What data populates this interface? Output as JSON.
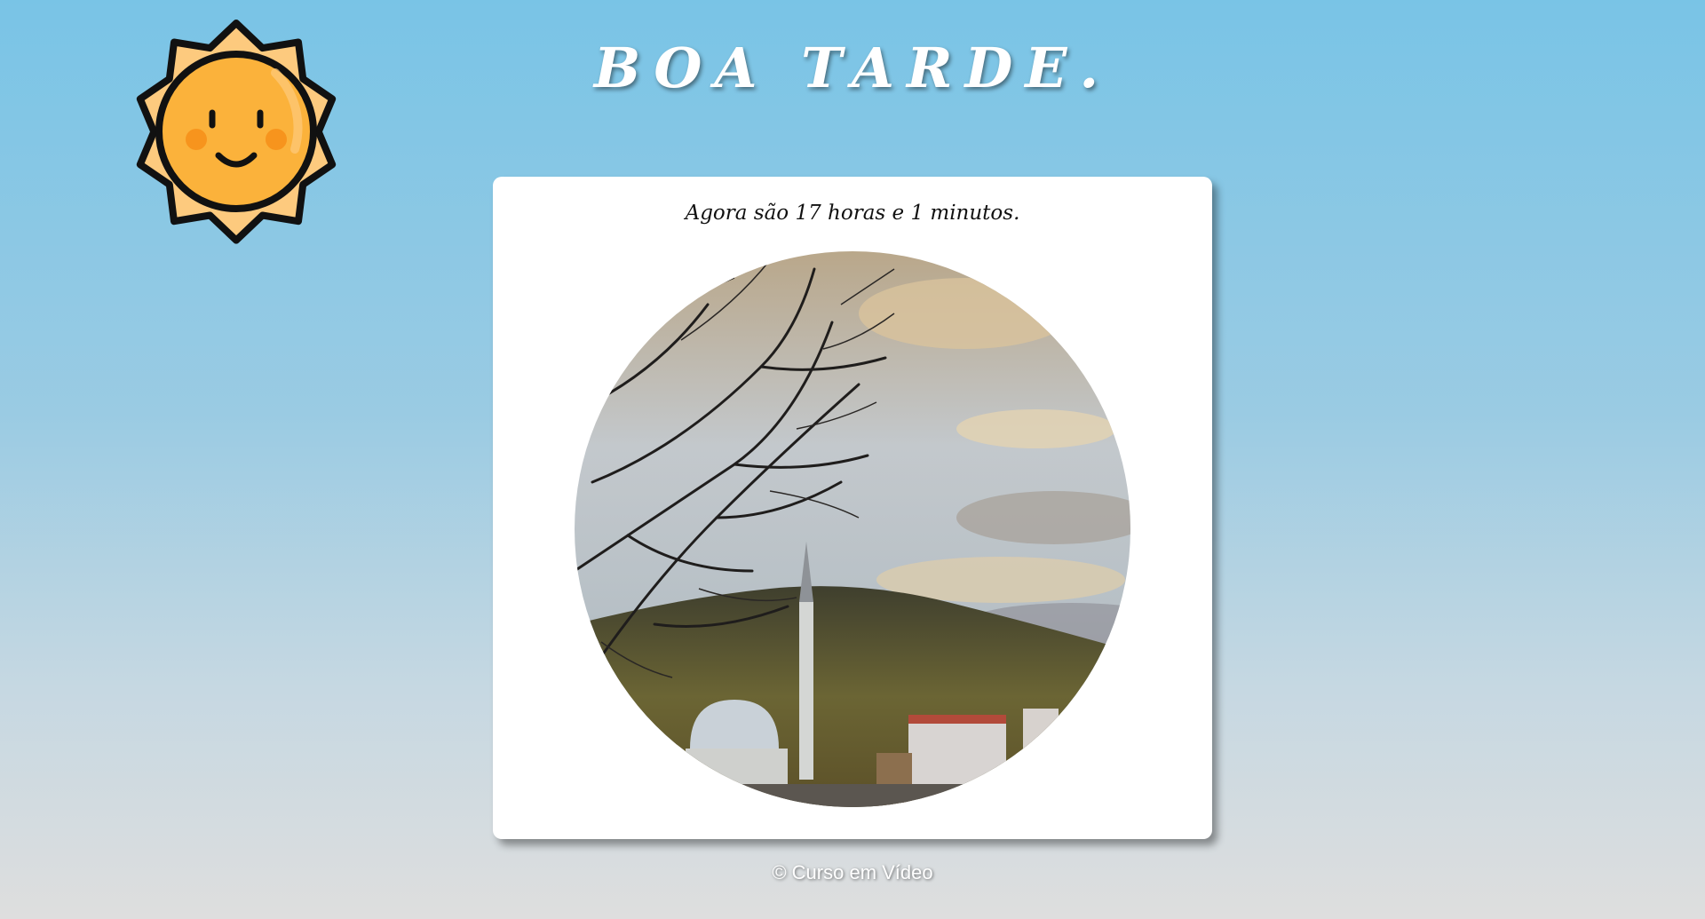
{
  "header": {
    "greeting": "BOA TARDE."
  },
  "card": {
    "time_message": "Agora são 17 horas e 1 minutos."
  },
  "footer": {
    "text": "© Curso em Vídeo"
  },
  "icons": {
    "period_icon": "sun-icon"
  },
  "colors": {
    "background_top": "#79c4e6",
    "background_bottom": "#dedede",
    "sun_body": "#fbb23b",
    "sun_rays": "#fdca7e",
    "card": "#ffffff"
  }
}
